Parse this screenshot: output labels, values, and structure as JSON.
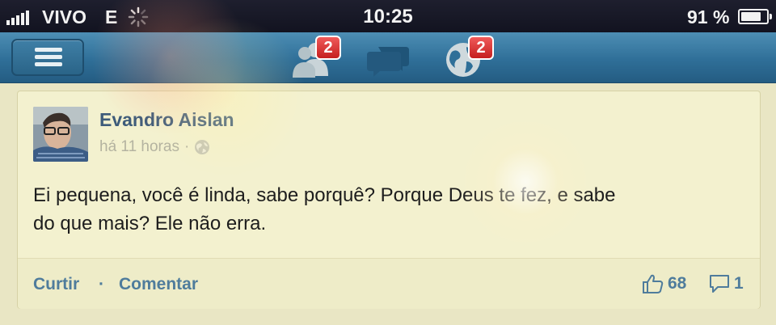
{
  "status_bar": {
    "carrier": "VIVO",
    "network": "E",
    "time": "10:25",
    "battery_percent": "91 %",
    "battery_level": 0.91
  },
  "nav": {
    "friend_requests_badge": "2",
    "notifications_badge": "2",
    "icons": [
      "menu-icon",
      "friend-requests-icon",
      "messages-icon",
      "notifications-globe-icon"
    ]
  },
  "post": {
    "author": "Evandro Aislan",
    "timestamp": "há 11 horas",
    "separator": "·",
    "text_line1": "Ei pequena, você é linda, sabe porquê? Porque Deus te fez, e sabe",
    "text_line2": "do que mais? Ele não erra.",
    "like_label": "Curtir",
    "dot": "·",
    "comment_label": "Comentar",
    "like_count": "68",
    "comment_count": "1"
  },
  "colors": {
    "nav": "#2f6f98",
    "link": "#4f7c9c",
    "author": "#3d5b7a",
    "badge": "#d62b2b"
  }
}
